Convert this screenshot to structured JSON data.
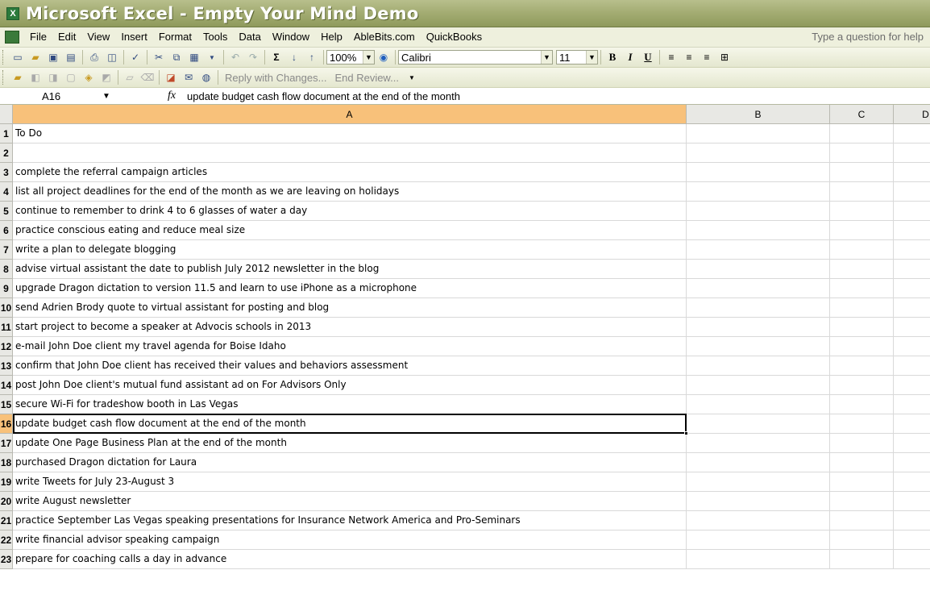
{
  "window": {
    "title": "Microsoft Excel - Empty Your Mind Demo"
  },
  "menu": {
    "items": [
      "File",
      "Edit",
      "View",
      "Insert",
      "Format",
      "Tools",
      "Data",
      "Window",
      "Help",
      "AbleBits.com",
      "QuickBooks"
    ],
    "help_placeholder": "Type a question for help"
  },
  "toolbar": {
    "zoom": "100%",
    "font": "Calibri",
    "font_size": "11",
    "bold": "B",
    "italic": "I",
    "underline": "U",
    "reply_with_changes": "Reply with Changes...",
    "end_review": "End Review..."
  },
  "formula_bar": {
    "name_box": "A16",
    "fx": "fx",
    "content": "update budget cash flow document at the end of the month"
  },
  "grid": {
    "columns": [
      "A",
      "B",
      "C",
      "D"
    ],
    "active_column": "A",
    "active_row": 16,
    "rows": [
      {
        "num": "1",
        "a": "To Do"
      },
      {
        "num": "2",
        "a": ""
      },
      {
        "num": "3",
        "a": "complete the referral campaign articles"
      },
      {
        "num": "4",
        "a": "list all project deadlines for the end of the month as we are leaving on holidays"
      },
      {
        "num": "5",
        "a": "continue to remember to drink 4 to 6 glasses of water a day"
      },
      {
        "num": "6",
        "a": "practice conscious eating and reduce meal size"
      },
      {
        "num": "7",
        "a": "write a plan to delegate blogging"
      },
      {
        "num": "8",
        "a": "advise virtual assistant the date to publish July 2012 newsletter in the blog"
      },
      {
        "num": "9",
        "a": "upgrade Dragon dictation to version 11.5 and learn to use iPhone as a microphone"
      },
      {
        "num": "10",
        "a": "send Adrien Brody quote to virtual assistant for posting and blog"
      },
      {
        "num": "11",
        "a": "start project to become a speaker at Advocis schools in 2013"
      },
      {
        "num": "12",
        "a": "e-mail John Doe client my travel agenda for Boise Idaho"
      },
      {
        "num": "13",
        "a": "confirm that John Doe client has received their values and behaviors assessment"
      },
      {
        "num": "14",
        "a": "post John Doe client's mutual fund assistant ad on For Advisors Only"
      },
      {
        "num": "15",
        "a": "secure Wi-Fi for tradeshow booth in Las Vegas"
      },
      {
        "num": "16",
        "a": "update budget cash flow document at the end of the month"
      },
      {
        "num": "17",
        "a": "update One Page Business Plan at the end of the month"
      },
      {
        "num": "18",
        "a": "purchased Dragon dictation for Laura"
      },
      {
        "num": "19",
        "a": "write Tweets for July 23-August 3"
      },
      {
        "num": "20",
        "a": "write August newsletter"
      },
      {
        "num": "21",
        "a": "practice September Las Vegas speaking presentations for Insurance Network America and Pro-Seminars"
      },
      {
        "num": "22",
        "a": "write financial advisor speaking campaign"
      },
      {
        "num": "23",
        "a": "prepare for coaching calls a day in advance"
      }
    ]
  },
  "colors": {
    "title_bar": "#a4ad74",
    "active_header": "#f8c17a",
    "gridline": "#d9d9d9"
  }
}
